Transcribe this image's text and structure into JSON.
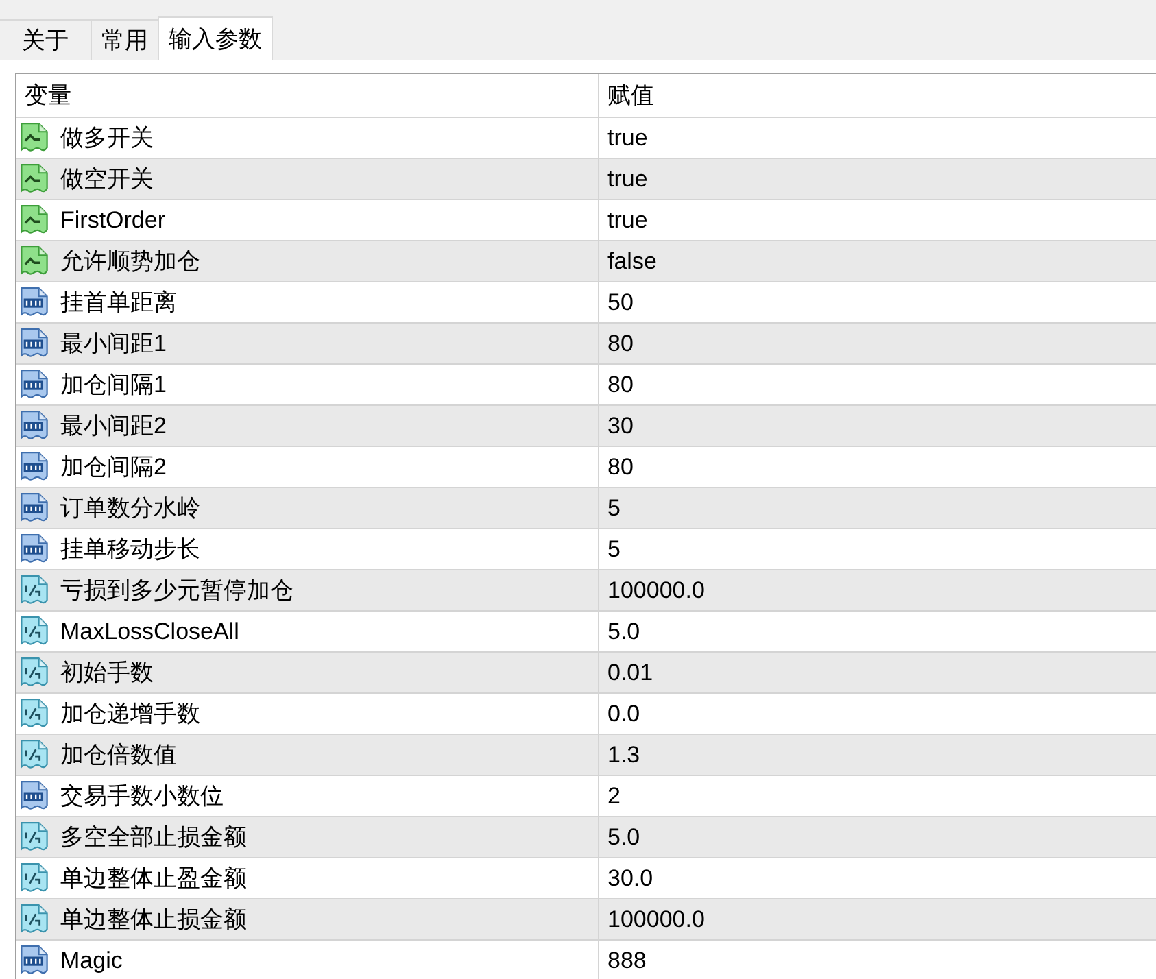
{
  "tabs": [
    {
      "label": "关于",
      "selected": false
    },
    {
      "label": "常用",
      "selected": false
    },
    {
      "label": "输入参数",
      "selected": true
    }
  ],
  "table": {
    "columns": [
      "变量",
      "赋值"
    ],
    "rows": [
      {
        "kind": "bool",
        "name": "做多开关",
        "value": "true"
      },
      {
        "kind": "bool",
        "name": "做空开关",
        "value": "true"
      },
      {
        "kind": "bool",
        "name": "FirstOrder",
        "value": "true"
      },
      {
        "kind": "bool",
        "name": "允许顺势加仓",
        "value": "false"
      },
      {
        "kind": "int",
        "name": "挂首单距离",
        "value": "50"
      },
      {
        "kind": "int",
        "name": "最小间距1",
        "value": "80"
      },
      {
        "kind": "int",
        "name": "加仓间隔1",
        "value": "80"
      },
      {
        "kind": "int",
        "name": "最小间距2",
        "value": "30"
      },
      {
        "kind": "int",
        "name": "加仓间隔2",
        "value": "80"
      },
      {
        "kind": "int",
        "name": "订单数分水岭",
        "value": "5"
      },
      {
        "kind": "int",
        "name": "挂单移动步长",
        "value": "5"
      },
      {
        "kind": "double",
        "name": "亏损到多少元暂停加仓",
        "value": "100000.0"
      },
      {
        "kind": "double",
        "name": "MaxLossCloseAll",
        "value": "5.0"
      },
      {
        "kind": "double",
        "name": "初始手数",
        "value": "0.01"
      },
      {
        "kind": "double",
        "name": "加仓递增手数",
        "value": "0.0"
      },
      {
        "kind": "double",
        "name": "加仓倍数值",
        "value": "1.3"
      },
      {
        "kind": "int",
        "name": "交易手数小数位",
        "value": "2"
      },
      {
        "kind": "double",
        "name": "多空全部止损金额",
        "value": "5.0"
      },
      {
        "kind": "double",
        "name": "单边整体止盈金额",
        "value": "30.0"
      },
      {
        "kind": "double",
        "name": "单边整体止损金额",
        "value": "100000.0"
      },
      {
        "kind": "int",
        "name": "Magic",
        "value": "888"
      }
    ]
  }
}
